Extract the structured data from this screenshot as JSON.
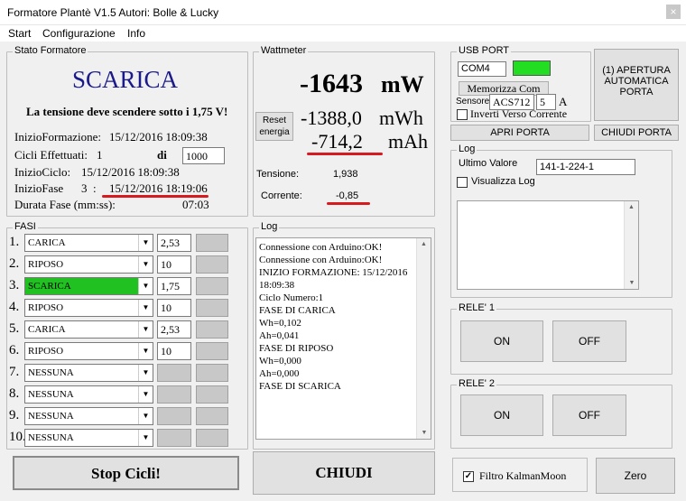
{
  "window": {
    "title": "Formatore Plantè V1.5 Autori: Bolle & Lucky",
    "close": "×"
  },
  "menu": [
    "Start",
    "Configurazione",
    "Info"
  ],
  "stato": {
    "group_label": "Stato Formatore",
    "mode": "SCARICA",
    "message": "La tensione deve scendere sotto i 1,75 V!",
    "inizio_formazione_label": "InizioFormazione:",
    "inizio_formazione_value": "15/12/2016 18:09:38",
    "cicli_label": "Cicli Effettuati:",
    "cicli_value": "1",
    "di_label": "di",
    "cicli_total": "1000",
    "inizio_ciclo_label": "InizioCiclo:",
    "inizio_ciclo_value": "15/12/2016 18:09:38",
    "inizio_fase_label": "InizioFase",
    "inizio_fase_num": "3",
    "inizio_fase_colon": ":",
    "inizio_fase_value": "15/12/2016 18:19:06",
    "durata_label": "Durata Fase (mm:ss):",
    "durata_value": "07:03"
  },
  "wattmeter": {
    "group_label": "Wattmeter",
    "power_value": "-1643",
    "power_unit": "mW",
    "reset_label": "Reset energia",
    "energy_value": "-1388,0",
    "energy_unit": "mWh",
    "charge_value": "-714,2",
    "charge_unit": "mAh",
    "tensione_label": "Tensione:",
    "tensione_value": "1,938",
    "corrente_label": "Corrente:",
    "corrente_value": "-0,85"
  },
  "usb": {
    "group_label": "USB PORT",
    "port": "COM4",
    "status_color": "#22dd22",
    "memorizza_label": "Memorizza Com",
    "sensore_label": "Sensore",
    "sensor_model": "ACS712",
    "sensor_amps": "5",
    "amp_unit": "A",
    "invert_label": "Inverti Verso Corrente",
    "apertura_label": "(1) APERTURA AUTOMATICA PORTA",
    "apri_label": "APRI PORTA",
    "chiudi_porta_label": "CHIUDI PORTA"
  },
  "log_right": {
    "group_label": "Log",
    "ultimo_label": "Ultimo Valore",
    "ultimo_value": "141-1-224-1",
    "visualizza_label": "Visualizza Log"
  },
  "rele1": {
    "group_label": "RELE' 1",
    "on": "ON",
    "off": "OFF"
  },
  "rele2": {
    "group_label": "RELE' 2",
    "on": "ON",
    "off": "OFF"
  },
  "fasi": {
    "group_label": "FASI",
    "rows": [
      {
        "num": "1.",
        "type": "CARICA",
        "value": "2,53",
        "active": false
      },
      {
        "num": "2.",
        "type": "RIPOSO",
        "value": "10",
        "active": false
      },
      {
        "num": "3.",
        "type": "SCARICA",
        "value": "1,75",
        "active": true
      },
      {
        "num": "4.",
        "type": "RIPOSO",
        "value": "10",
        "active": false
      },
      {
        "num": "5.",
        "type": "CARICA",
        "value": "2,53",
        "active": false
      },
      {
        "num": "6.",
        "type": "RIPOSO",
        "value": "10",
        "active": false
      },
      {
        "num": "7.",
        "type": "NESSUNA",
        "value": "",
        "active": false
      },
      {
        "num": "8.",
        "type": "NESSUNA",
        "value": "",
        "active": false
      },
      {
        "num": "9.",
        "type": "NESSUNA",
        "value": "",
        "active": false
      },
      {
        "num": "10.",
        "type": "NESSUNA",
        "value": "",
        "active": false
      }
    ],
    "active_color": "#22c122"
  },
  "log": {
    "group_label": "Log",
    "lines": [
      "Connessione con Arduino:OK!",
      "Connessione con Arduino:OK!",
      "INIZIO FORMAZIONE: 15/12/2016",
      "18:09:38",
      "Ciclo Numero:1",
      "FASE DI CARICA",
      "Wh=0,102",
      "Ah=0,041",
      "FASE DI RIPOSO",
      "Wh=0,000",
      "Ah=0,000",
      "FASE DI SCARICA"
    ]
  },
  "buttons": {
    "stop": "Stop Cicli!",
    "chiudi": "CHIUDI",
    "filtro": "Filtro KalmanMoon",
    "zero": "Zero"
  },
  "colors": {
    "mode_blue": "#1a1a8c",
    "annotation_red": "#d71920"
  }
}
